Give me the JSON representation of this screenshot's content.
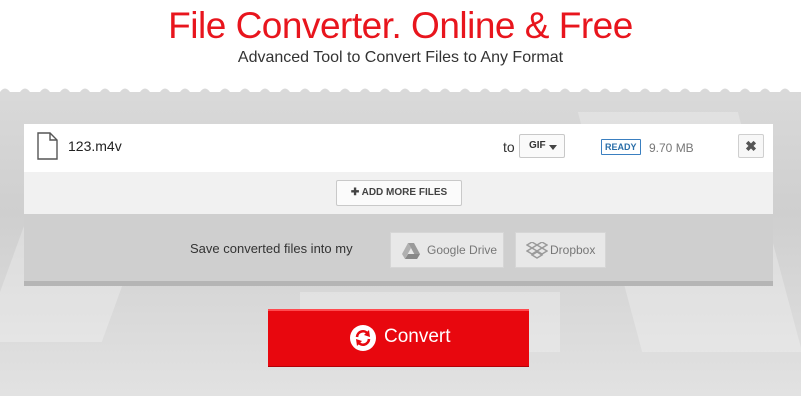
{
  "header": {
    "title": "File Converter. Online & Free",
    "subtitle": "Advanced Tool to Convert Files to Any Format"
  },
  "file": {
    "name": "123.m4v",
    "to_label": "to",
    "format": "GIF",
    "status": "READY",
    "size": "9.70 MB",
    "remove_icon": "close-icon"
  },
  "add_more": {
    "label": "ADD MORE FILES",
    "icon": "plus-icon"
  },
  "save": {
    "label": "Save converted files into my",
    "google_drive": "Google Drive",
    "dropbox": "Dropbox"
  },
  "convert": {
    "label": "Convert",
    "icon": "refresh-icon"
  },
  "colors": {
    "brand_red": "#e8151d",
    "button_red": "#e8070e",
    "badge_blue": "#2a6ea8"
  }
}
